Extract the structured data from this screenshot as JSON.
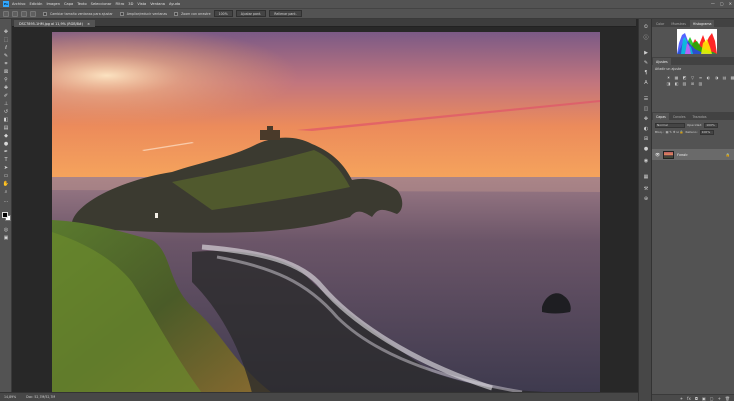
{
  "menubar": {
    "logo": "Ps",
    "items": [
      "Archivo",
      "Edición",
      "Imagen",
      "Capa",
      "Texto",
      "Seleccionar",
      "Filtro",
      "3D",
      "Vista",
      "Ventana",
      "Ayuda"
    ],
    "window_controls": [
      "—",
      "▢",
      "✕"
    ]
  },
  "options_bar": {
    "resize_windows_label": "Cambiar tamaño ventanas para ajustar",
    "zoom_all_label": "Ampliar/reducir ventanas",
    "scrubby_zoom_label": "Zoom con arrastre",
    "zoom_level": "100%",
    "fit_screen_label": "Ajustar pant.",
    "fill_screen_label": "Rellenar pant."
  },
  "document_tab": {
    "label": "DSC7895-1HM.jpg al 11,9% (RGB/8#)",
    "close": "×"
  },
  "status_bar": {
    "zoom": "14,89%",
    "doc_size": "Doc: 52,7M/52,7M"
  },
  "panels": {
    "histogram_tabs": [
      "Color",
      "Muestras",
      "Histograma"
    ],
    "histogram_active": "Histograma",
    "adjustments_tabs": [
      "Ajustes"
    ],
    "adjustments_title": "Añadir un ajuste",
    "adjustment_icons": [
      "☀",
      "▦",
      "◩",
      "▽",
      "≡",
      "◐",
      "◑",
      "▤",
      "▩",
      "⊟",
      "◨",
      "◧",
      "▨",
      "⊞",
      "▥"
    ],
    "layers_tabs": [
      "Capas",
      "Canales",
      "Trazados"
    ],
    "layers_active": "Capas",
    "blend_mode": "Normal",
    "opacity_label": "Opacidad:",
    "opacity": "100%",
    "fill_label": "Relleno:",
    "fill": "100%",
    "lock_label": "Bloq.:",
    "layer_name": "Fondo",
    "footer_icons": [
      "fx",
      "◘",
      "▣",
      "▢",
      "+",
      "🗑"
    ]
  },
  "colors": {
    "ui_panel": "#535353",
    "ui_dark": "#282828",
    "ps_blue": "#31a8ff"
  }
}
